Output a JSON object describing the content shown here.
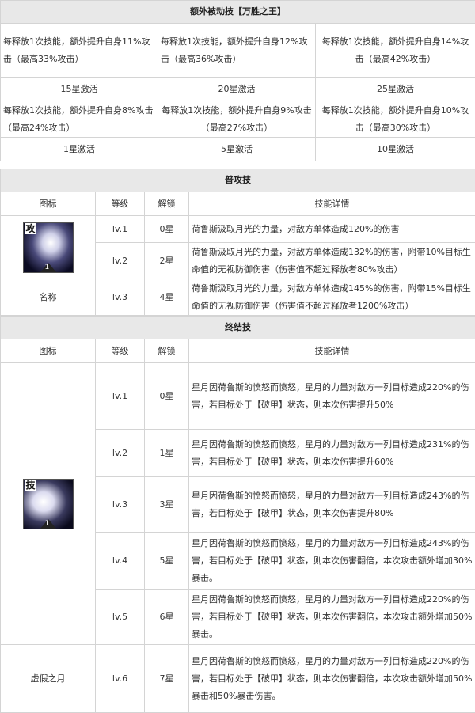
{
  "passive": {
    "title": "额外被动技【万胜之王】",
    "rows": [
      {
        "effects": [
          "每释放1次技能，额外提升自身11%攻击（最高33%攻击）",
          "每释放1次技能，额外提升自身12%攻击（最高36%攻击）",
          "每释放1次技能，额外提升自身14%攻击（最高42%攻击）"
        ],
        "activations": [
          "15星激活",
          "20星激活",
          "25星激活"
        ]
      },
      {
        "effects": [
          "每释放1次技能，额外提升自身8%攻击（最高24%攻击）",
          "每释放1次技能，额外提升自身9%攻击（最高27%攻击）",
          "每释放1次技能，额外提升自身10%攻击（最高30%攻击）"
        ],
        "activations": [
          "1星激活",
          "5星激活",
          "10星激活"
        ]
      }
    ]
  },
  "headers": {
    "icon": "图标",
    "level": "等级",
    "unlock": "解锁",
    "detail": "技能详情"
  },
  "normal_attack": {
    "title": "普攻技",
    "icon_tag": "攻",
    "icon_level": "1",
    "name_label": "名称",
    "rows": [
      {
        "level": "lv.1",
        "unlock": "0星",
        "detail": "荷鲁斯汲取月光的力量，对敌方单体造成120%的伤害"
      },
      {
        "level": "lv.2",
        "unlock": "2星",
        "detail": "荷鲁斯汲取月光的力量，对敌方单体造成132%的伤害，附带10%目标生命值的无视防御伤害（伤害值不超过释放者80%攻击）"
      },
      {
        "level": "lv.3",
        "unlock": "4星",
        "detail": "荷鲁斯汲取月光的力量，对敌方单体造成145%的伤害，附带15%目标生命值的无视防御伤害（伤害值不超过释放者1200%攻击）"
      }
    ]
  },
  "finisher": {
    "title": "终结技",
    "icon_tag": "技",
    "icon_level": "1",
    "name": "虚假之月",
    "rows": [
      {
        "level": "lv.1",
        "unlock": "0星",
        "detail": "星月因荷鲁斯的愤怒而愤怒，星月的力量对敌方一列目标造成220%的伤害，若目标处于【破甲】状态，则本次伤害提升50%"
      },
      {
        "level": "lv.2",
        "unlock": "1星",
        "detail": "星月因荷鲁斯的愤怒而愤怒，星月的力量对敌方一列目标造成231%的伤害，若目标处于【破甲】状态，则本次伤害提升60%"
      },
      {
        "level": "lv.3",
        "unlock": "3星",
        "detail": "星月因荷鲁斯的愤怒而愤怒，星月的力量对敌方一列目标造成243%的伤害，若目标处于【破甲】状态，则本次伤害提升80%"
      },
      {
        "level": "lv.4",
        "unlock": "5星",
        "detail": "星月因荷鲁斯的愤怒而愤怒，星月的力量对敌方一列目标造成243%的伤害，若目标处于【破甲】状态，则本次伤害翻倍，本次攻击额外增加30%暴击。"
      },
      {
        "level": "lv.5",
        "unlock": "6星",
        "detail": "星月因荷鲁斯的愤怒而愤怒，星月的力量对敌方一列目标造成220%的伤害，若目标处于【破甲】状态，则本次伤害翻倍，本次攻击额外增加50%暴击。"
      },
      {
        "level": "lv.6",
        "unlock": "7星",
        "detail": "星月因荷鲁斯的愤怒而愤怒，星月的力量对敌方一列目标造成220%的伤害，若目标处于【破甲】状态，则本次伤害翻倍，本次攻击额外增加50%暴击和50%暴击伤害。"
      }
    ]
  }
}
